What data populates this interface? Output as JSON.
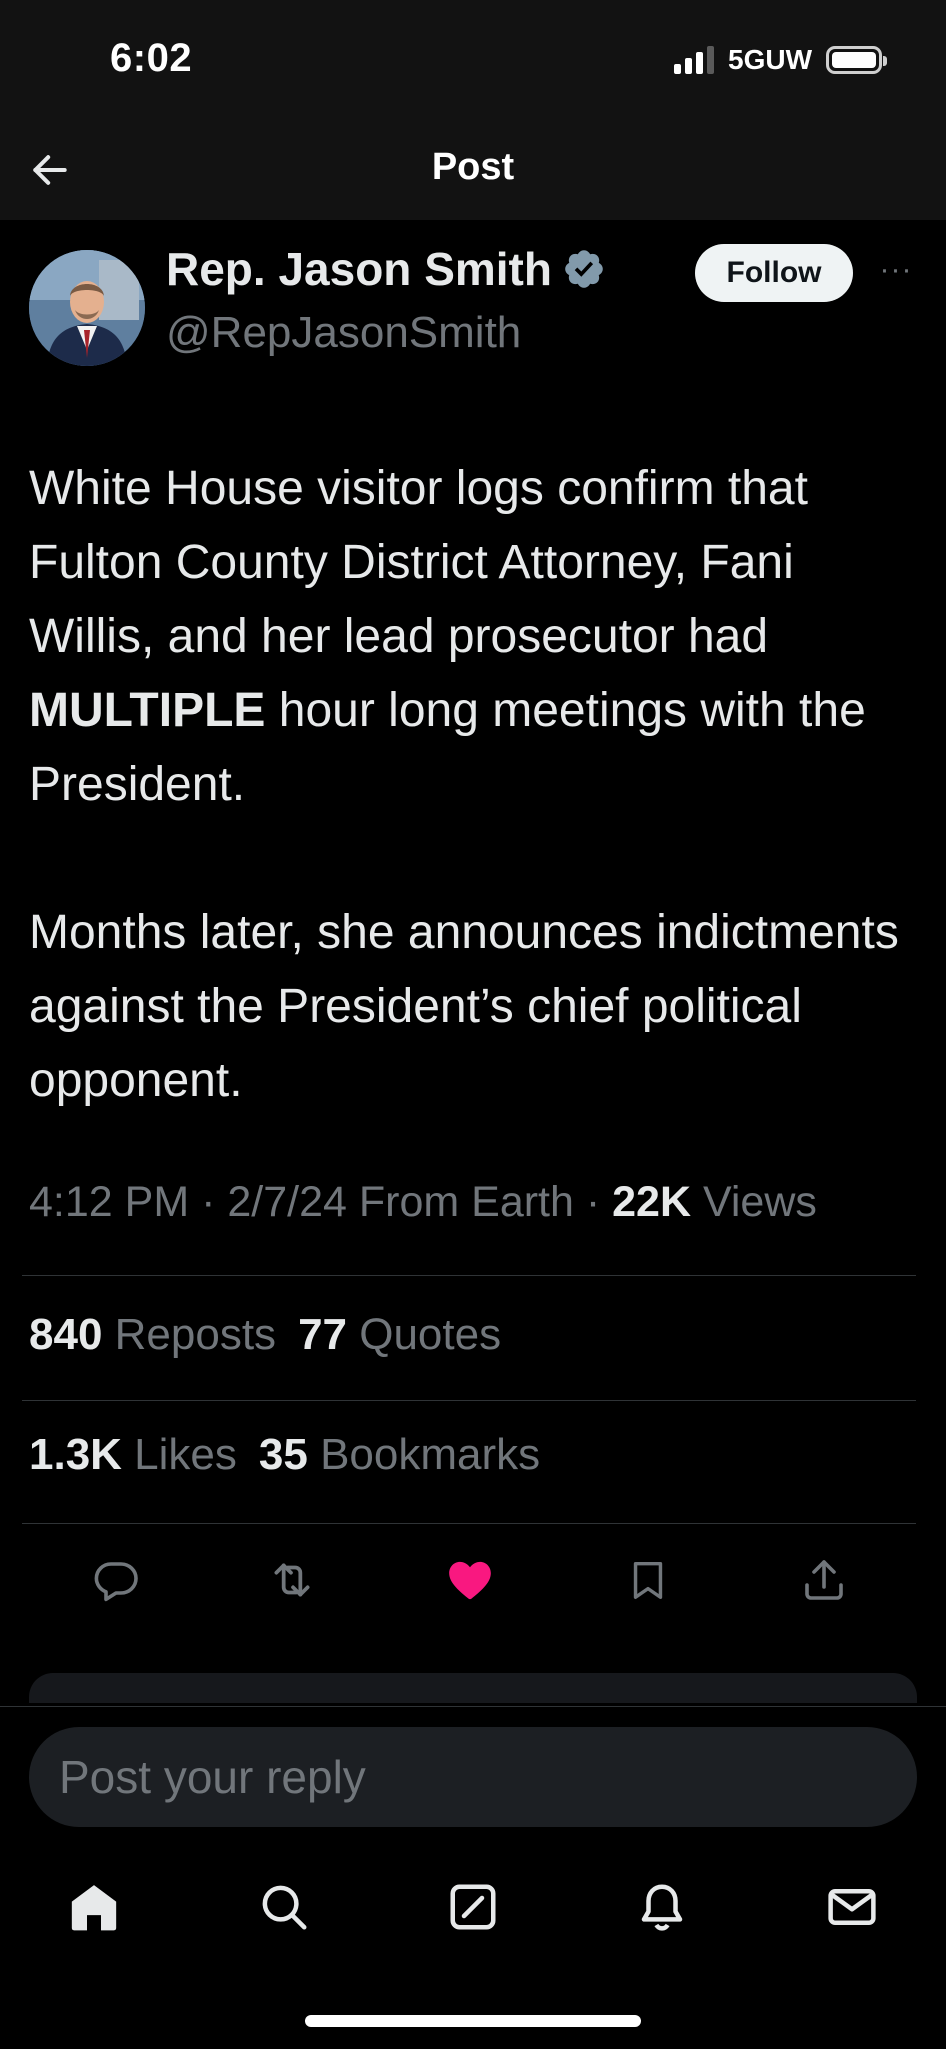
{
  "status_bar": {
    "time": "6:02",
    "network": "5GUW",
    "battery_level": 1.0
  },
  "nav": {
    "title": "Post",
    "back_icon": "arrow-left-icon"
  },
  "post": {
    "author": {
      "name": "Rep. Jason Smith",
      "handle": "@RepJasonSmith",
      "verified": true,
      "verified_color": "#829aab"
    },
    "follow_label": "Follow",
    "more_label": "···",
    "text": {
      "line1": "White House visitor logs confirm that Fulton County District Attorney, Fani Willis, and her lead prosecutor had",
      "emphasis": "MULTIPLE",
      "line1_rest": " hour long meetings with the President.",
      "para2": "Months later, she announces indictments against the President’s chief political opponent."
    },
    "meta": {
      "time": "4:12 PM",
      "sep1": " · ",
      "date": "2/7/24",
      "source": " From Earth",
      "sep2": " · ",
      "views_count": "22K",
      "views_label": " Views"
    },
    "stats": {
      "reposts_count": "840",
      "reposts_label": " Reposts",
      "quotes_count": "77",
      "quotes_label": " Quotes",
      "likes_count": "1.3K",
      "likes_label": " Likes",
      "bookmarks_count": "35",
      "bookmarks_label": " Bookmarks"
    },
    "actions": [
      {
        "icon": "reply-icon"
      },
      {
        "icon": "repost-icon"
      },
      {
        "icon": "like-icon",
        "active": true,
        "color": "#f91880"
      },
      {
        "icon": "bookmark-icon"
      },
      {
        "icon": "share-icon"
      }
    ]
  },
  "reply": {
    "placeholder": "Post your reply"
  },
  "tabbar": [
    {
      "icon": "home-icon",
      "active": true
    },
    {
      "icon": "search-icon"
    },
    {
      "icon": "grok-icon"
    },
    {
      "icon": "notifications-icon"
    },
    {
      "icon": "messages-icon"
    }
  ],
  "colors": {
    "background": "#000000",
    "text": "#e7e9ea",
    "secondary": "#71767b",
    "like": "#f91880"
  }
}
